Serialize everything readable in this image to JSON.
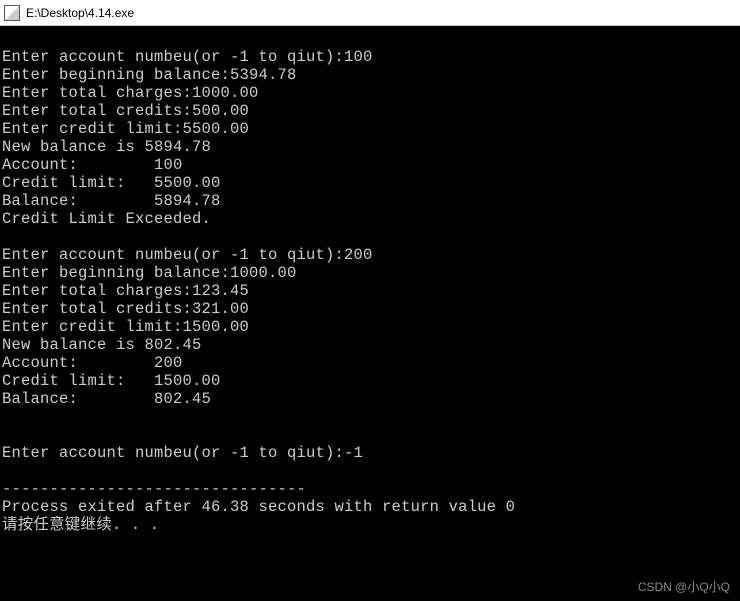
{
  "window": {
    "title": "E:\\Desktop\\4.14.exe"
  },
  "lines": {
    "l0": "Enter account numbeu(or -1 to qiut):100",
    "l1": "Enter beginning balance:5394.78",
    "l2": "Enter total charges:1000.00",
    "l3": "Enter total credits:500.00",
    "l4": "Enter credit limit:5500.00",
    "l5": "New balance is 5894.78",
    "l6": "Account:        100",
    "l7": "Credit limit:   5500.00",
    "l8": "Balance:        5894.78",
    "l9": "Credit Limit Exceeded.",
    "l10": "",
    "l11": "Enter account numbeu(or -1 to qiut):200",
    "l12": "Enter beginning balance:1000.00",
    "l13": "Enter total charges:123.45",
    "l14": "Enter total credits:321.00",
    "l15": "Enter credit limit:1500.00",
    "l16": "New balance is 802.45",
    "l17": "Account:        200",
    "l18": "Credit limit:   1500.00",
    "l19": "Balance:        802.45",
    "l20": "",
    "l21": "",
    "l22": "Enter account numbeu(or -1 to qiut):-1",
    "l23": "",
    "l24": "--------------------------------",
    "l25": "Process exited after 46.38 seconds with return value 0",
    "l26": "请按任意键继续. . ."
  },
  "watermark": "CSDN @小Q小Q"
}
